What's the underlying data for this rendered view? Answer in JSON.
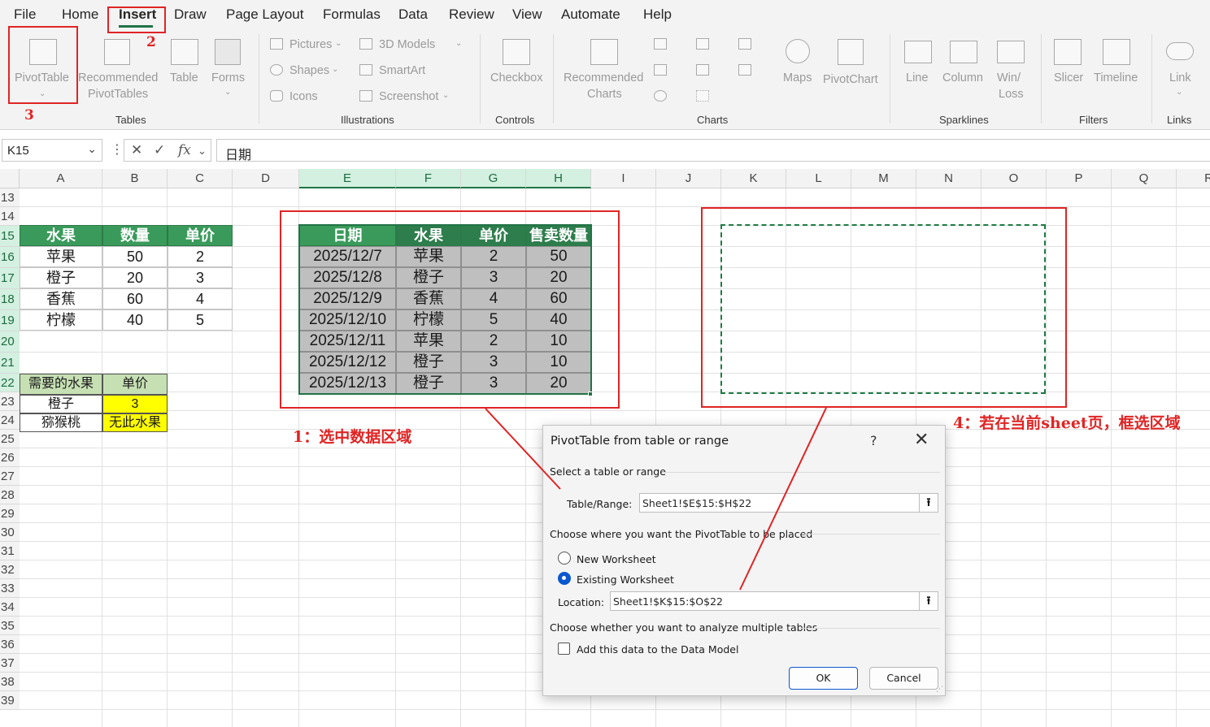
{
  "menu": {
    "items": [
      "File",
      "Home",
      "Insert",
      "Draw",
      "Page Layout",
      "Formulas",
      "Data",
      "Review",
      "View",
      "Automate",
      "Help"
    ],
    "active": "Insert"
  },
  "ribbon": {
    "tables": {
      "pivot_table": "PivotTable",
      "recommended_1": "Recommended",
      "recommended_2": "PivotTables",
      "table": "Table",
      "forms": "Forms",
      "group": "Tables"
    },
    "illustrations": {
      "pictures": "Pictures",
      "shapes": "Shapes",
      "icons": "Icons",
      "models_3d": "3D Models",
      "smartart": "SmartArt",
      "screenshot": "Screenshot",
      "group": "Illustrations"
    },
    "controls": {
      "checkbox": "Checkbox",
      "group": "Controls"
    },
    "charts": {
      "recommended_1": "Recommended",
      "recommended_2": "Charts",
      "maps": "Maps",
      "pivot_chart": "PivotChart",
      "group": "Charts"
    },
    "sparklines": {
      "line": "Line",
      "column": "Column",
      "winloss_1": "Win/",
      "winloss_2": "Loss",
      "group": "Sparklines"
    },
    "filters": {
      "slicer": "Slicer",
      "timeline": "Timeline",
      "group": "Filters"
    },
    "links": {
      "link": "Link",
      "group": "Links"
    }
  },
  "formula_bar": {
    "name_box": "K15",
    "fx": "fx",
    "content": "日期"
  },
  "columns": [
    "A",
    "B",
    "C",
    "D",
    "E",
    "F",
    "G",
    "H",
    "I",
    "J",
    "K",
    "L",
    "M",
    "N",
    "O",
    "P",
    "Q",
    "R"
  ],
  "rows": [
    "13",
    "14",
    "15",
    "16",
    "17",
    "18",
    "19",
    "20",
    "21",
    "22",
    "23",
    "24",
    "25",
    "26",
    "27",
    "28",
    "29",
    "30",
    "31",
    "32",
    "33",
    "34",
    "35",
    "36",
    "37",
    "38",
    "39"
  ],
  "small_table": {
    "headers": [
      "水果",
      "数量",
      "单价"
    ],
    "rows": [
      [
        "苹果",
        "50",
        "2"
      ],
      [
        "橙子",
        "20",
        "3"
      ],
      [
        "香蕉",
        "60",
        "4"
      ],
      [
        "柠檬",
        "40",
        "5"
      ]
    ]
  },
  "lookup": {
    "headers": [
      "需要的水果",
      "单价"
    ],
    "rows": [
      [
        "橙子",
        "3"
      ],
      [
        "猕猴桃",
        "无此水果"
      ]
    ]
  },
  "data_table": {
    "headers": [
      "日期",
      "水果",
      "单价",
      "售卖数量"
    ],
    "rows": [
      [
        "2025/12/7",
        "苹果",
        "2",
        "50"
      ],
      [
        "2025/12/8",
        "橙子",
        "3",
        "20"
      ],
      [
        "2025/12/9",
        "香蕉",
        "4",
        "60"
      ],
      [
        "2025/12/10",
        "柠檬",
        "5",
        "40"
      ],
      [
        "2025/12/11",
        "苹果",
        "2",
        "10"
      ],
      [
        "2025/12/12",
        "橙子",
        "3",
        "10"
      ],
      [
        "2025/12/13",
        "橙子",
        "3",
        "20"
      ]
    ]
  },
  "annotations": {
    "step2": "2",
    "step3": "3",
    "step1": "1：选中数据区域",
    "step4": "4：若在当前sheet页，框选区域"
  },
  "dialog": {
    "title": "PivotTable from table or range",
    "help": "?",
    "close": "✕",
    "section_select": "Select a table or range",
    "table_range_label": "Table/Range:",
    "table_range_value": "Sheet1!$E$15:$H$22",
    "section_place": "Choose where you want the PivotTable to be placed",
    "new_worksheet": "New Worksheet",
    "existing_worksheet": "Existing Worksheet",
    "location_label": "Location:",
    "location_value": "Sheet1!$K$15:$O$22",
    "section_multiple": "Choose whether you want to analyze multiple tables",
    "data_model": "Add this data to the Data Model",
    "ok": "OK",
    "cancel": "Cancel",
    "placement": "existing",
    "data_model_checked": false
  },
  "colors": {
    "accent_green": "#217346",
    "annotation_red": "#e02424",
    "table_header": "#3a9a5b",
    "lookup_yellow": "#ffff00",
    "selection_gray": "#bfbfbf"
  }
}
